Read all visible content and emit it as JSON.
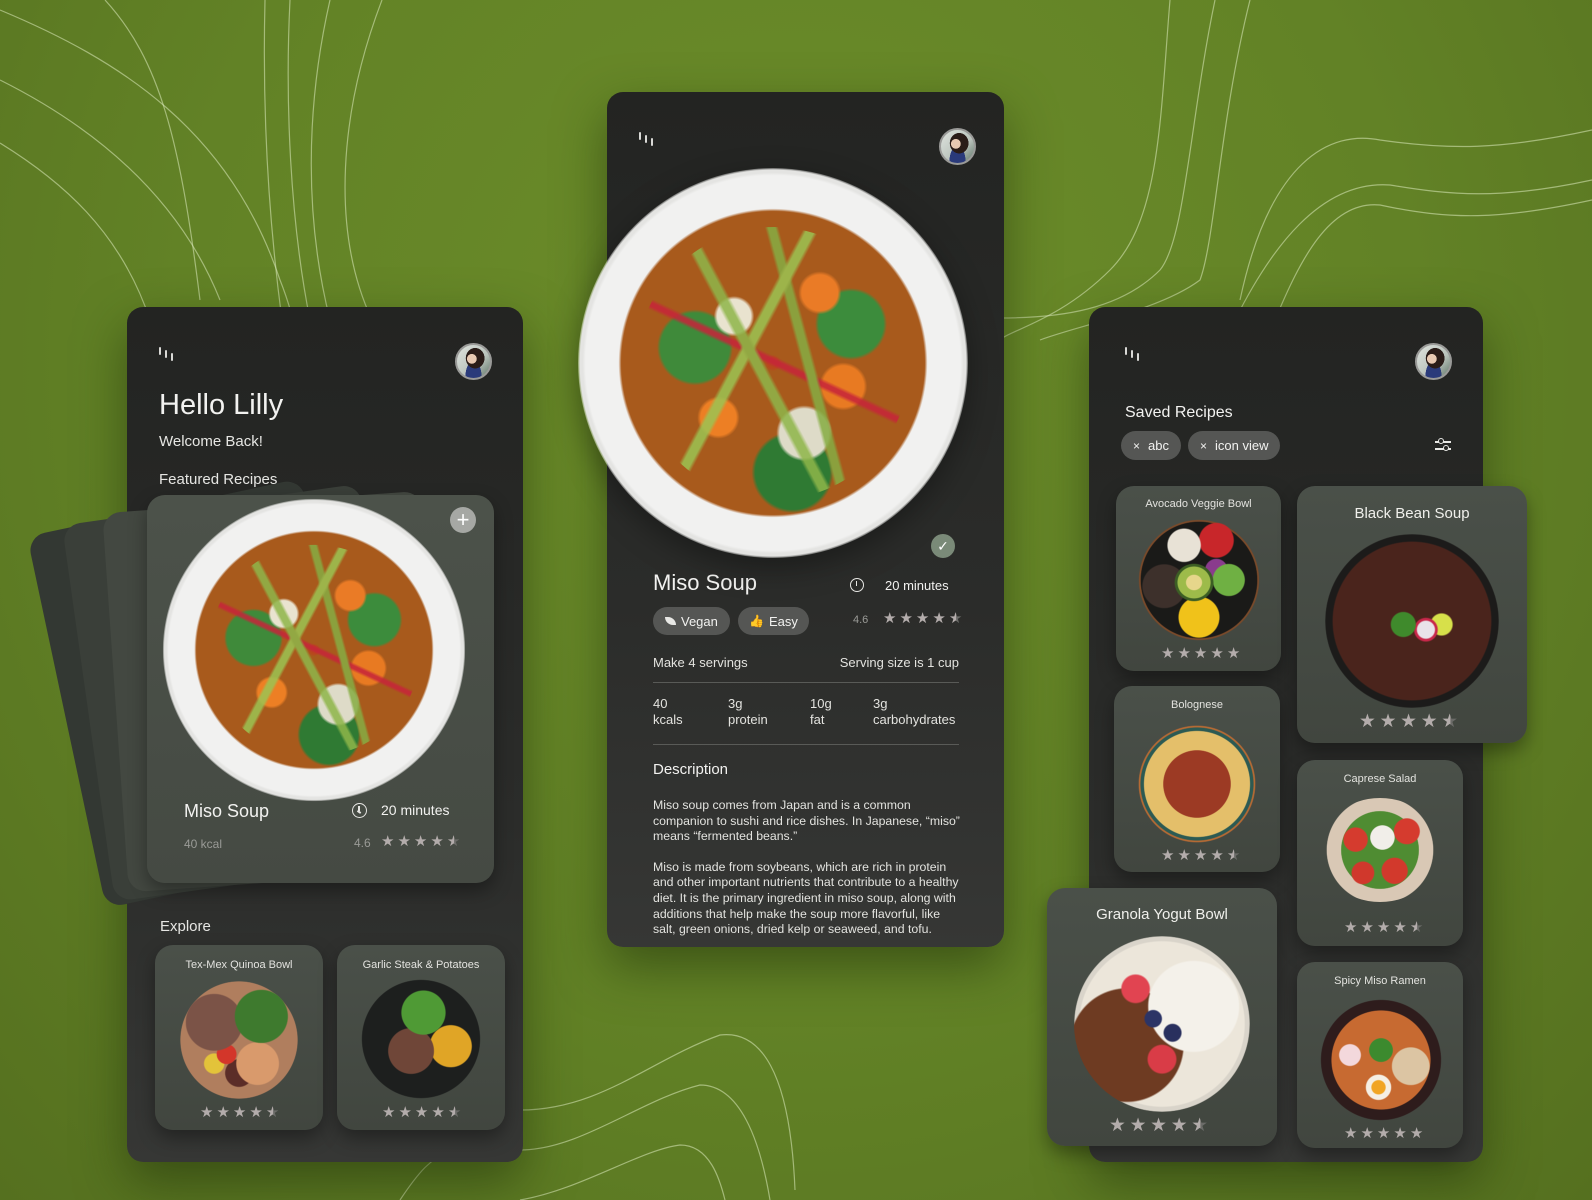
{
  "colors": {
    "background": "#658628",
    "panel": "#262725",
    "card": "#474c45",
    "star": "#b3acab",
    "chip": "#555654",
    "check_badge": "#7a8a78"
  },
  "home": {
    "menu_icon": "menu-icon",
    "avatar_icon": "user-avatar",
    "greeting": "Hello Lilly",
    "subtitle": "Welcome Back!",
    "featured_heading": "Featured Recipes",
    "featured": {
      "add_icon": "plus-icon",
      "name": "Miso Soup",
      "time_icon": "clock-icon",
      "time": "20 minutes",
      "calories": "40 kcal",
      "rating": "4.6",
      "stars": 4.5
    },
    "explore_heading": "Explore",
    "explore": [
      {
        "name": "Tex-Mex Quinoa Bowl",
        "stars": 4.5
      },
      {
        "name": "Garlic Steak & Potatoes",
        "stars": 4.5
      }
    ]
  },
  "detail": {
    "menu_icon": "menu-icon",
    "avatar_icon": "user-avatar",
    "saved_icon": "check-icon",
    "title": "Miso Soup",
    "time_icon": "clock-icon",
    "time": "20 minutes",
    "tags": [
      {
        "icon": "leaf-icon",
        "label": "Vegan"
      },
      {
        "icon": "thumbs-up-icon",
        "label": "Easy"
      }
    ],
    "rating": "4.6",
    "stars": 4.5,
    "servings": "Make 4 servings",
    "serving_size": "Serving size is 1 cup",
    "nutrition": [
      {
        "value": "40",
        "label": "kcals"
      },
      {
        "value": "3g",
        "label": "protein"
      },
      {
        "value": "10g",
        "label": "fat"
      },
      {
        "value": "3g",
        "label": "carbohydrates"
      }
    ],
    "description_heading": "Description",
    "description_p1": "Miso soup comes from Japan and is a common companion to sushi and rice dishes. In Japanese, “miso” means “fermented beans.”",
    "description_p2": "Miso is made from soybeans, which are rich in protein and other important nutrients that contribute to a healthy diet. It is the primary ingredient in miso soup, along with additions that help make the soup more flavorful, like salt, green onions, dried kelp or seaweed, and tofu."
  },
  "saved": {
    "menu_icon": "menu-icon",
    "avatar_icon": "user-avatar",
    "heading": "Saved Recipes",
    "filters": [
      {
        "label": "abc"
      },
      {
        "label": "icon view"
      }
    ],
    "filter_icon": "sliders-icon",
    "recipes": [
      {
        "name": "Avocado Veggie Bowl",
        "stars": 5
      },
      {
        "name": "Black Bean Soup",
        "stars": 4.5
      },
      {
        "name": "Bolognese",
        "stars": 4.5
      },
      {
        "name": "Caprese Salad",
        "stars": 4.5
      },
      {
        "name": "Granola Yogut Bowl",
        "stars": 4.5
      },
      {
        "name": "Spicy Miso Ramen",
        "stars": 5
      }
    ]
  }
}
